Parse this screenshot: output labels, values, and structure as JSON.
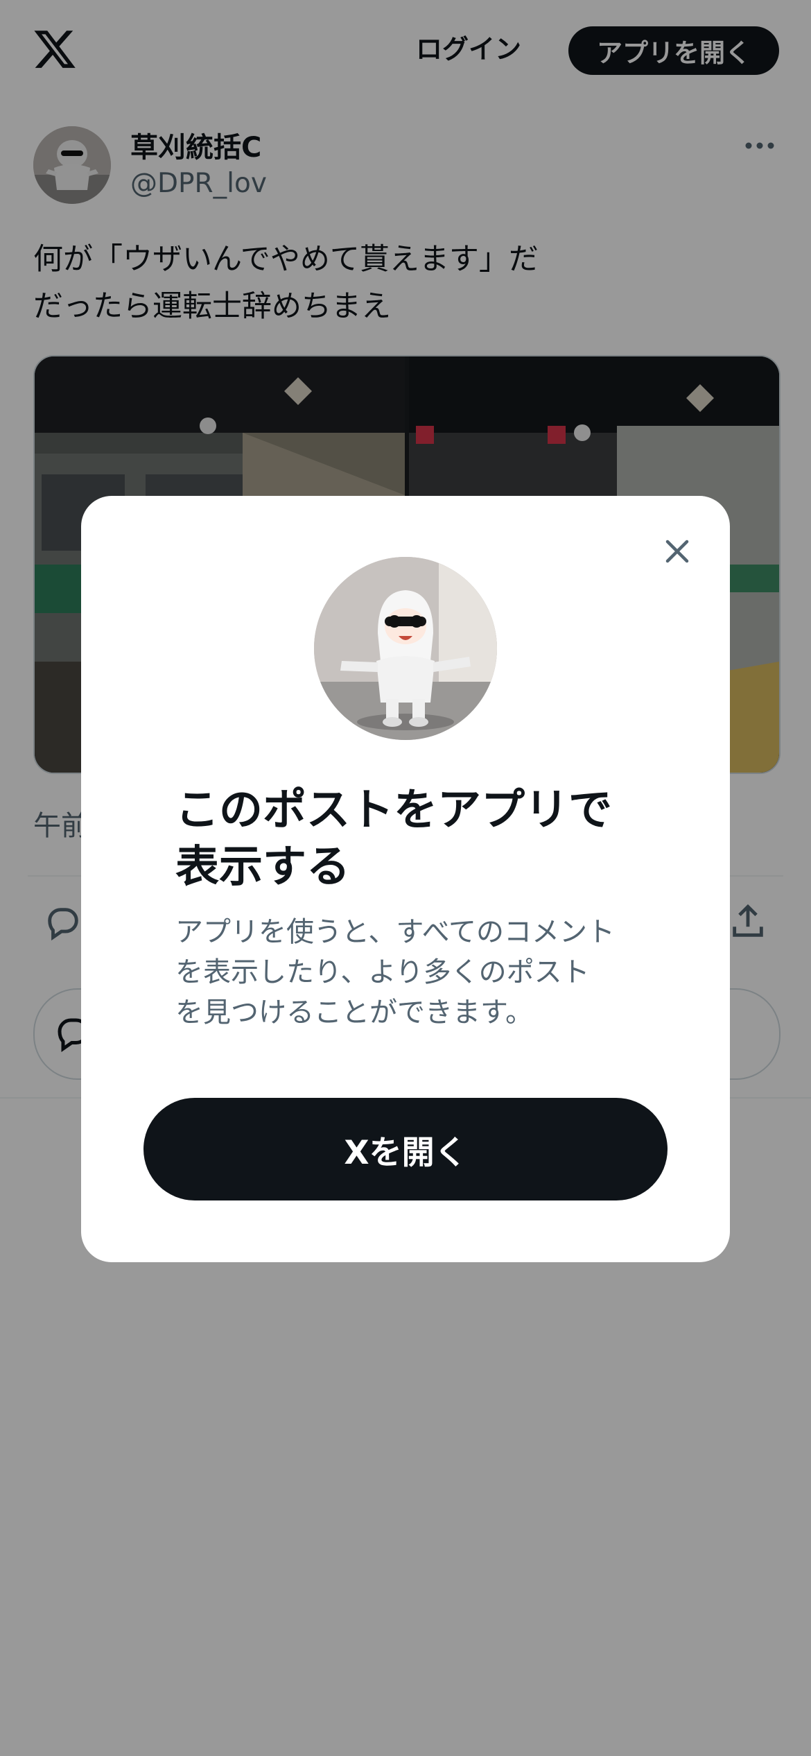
{
  "header": {
    "logo_icon": "x-logo-icon",
    "login_label": "ログイン",
    "open_app_label": "アプリを開く"
  },
  "post": {
    "display_name": "草刈統括C",
    "handle": "@DPR_lov",
    "text_line1": "何が「ウザいんでやめて貰えます」だ",
    "text_line2": "だったら運転士辞めちまえ",
    "timestamp_visible": "午前",
    "more_icon": "more-horizontal-icon",
    "reply_icon": "reply-icon",
    "share_icon": "share-icon"
  },
  "modal": {
    "close_icon": "close-icon",
    "title_line1": "このポストをアプリで",
    "title_line2": "表示する",
    "desc_line1": "アプリを使うと、すべてのコメント",
    "desc_line2": "を表示したり、より多くのポスト",
    "desc_line3": "を見つけることができます。",
    "open_button_label": "Xを開く"
  },
  "colors": {
    "primary_text": "#0f1419",
    "secondary_text": "#536471",
    "button_bg": "#0f1419",
    "overlay": "rgba(0,0,0,0.4)"
  }
}
